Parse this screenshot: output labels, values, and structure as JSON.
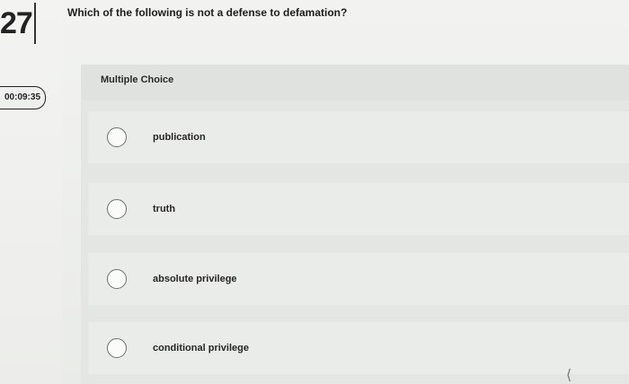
{
  "question": {
    "number": "27",
    "text": "Which of the following is not a defense to defamation?"
  },
  "timer": {
    "value": "00:09:35"
  },
  "section": {
    "label": "Multiple Choice"
  },
  "choices": [
    {
      "label": "publication"
    },
    {
      "label": "truth"
    },
    {
      "label": "absolute privilege"
    },
    {
      "label": "conditional privilege"
    }
  ],
  "icons": {
    "radio": "radio-unselected-icon"
  }
}
